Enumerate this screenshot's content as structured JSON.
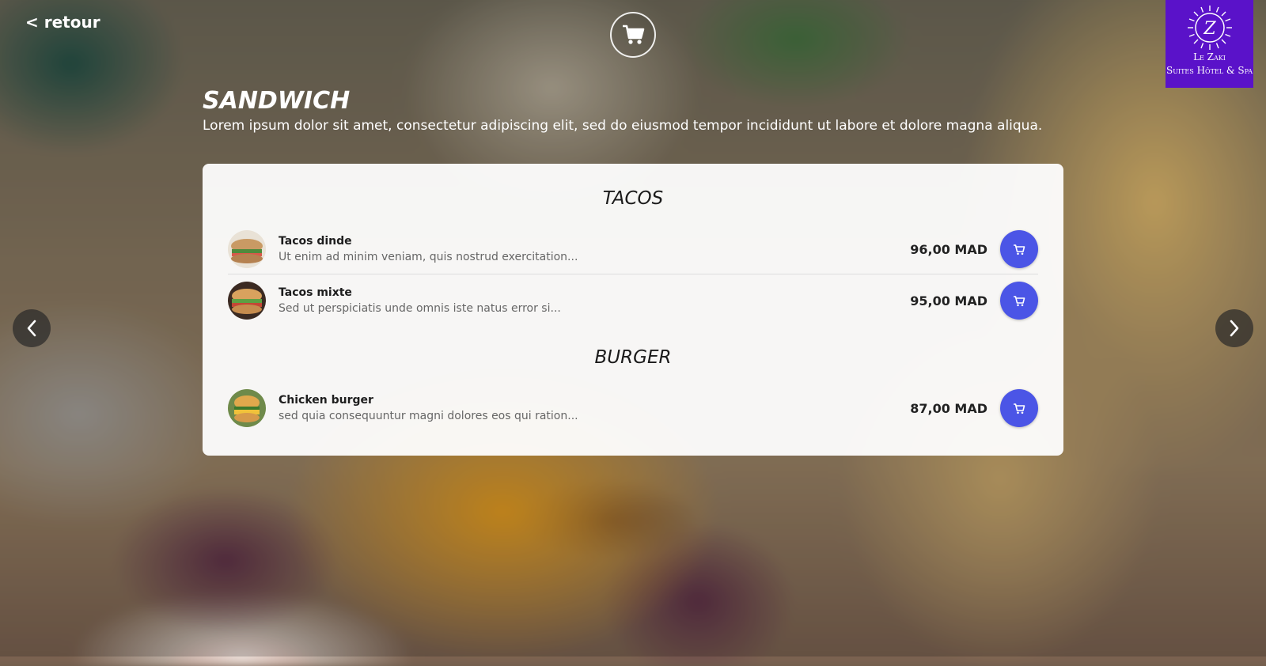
{
  "header": {
    "back_label": "< retour",
    "logo_line1": "Le Zaki",
    "logo_line2": "Suites Hôtel & Spa",
    "logo_mark": "Z"
  },
  "category": {
    "title": "SANDWICH",
    "description": "Lorem ipsum dolor sit amet, consectetur adipiscing elit, sed do eiusmod tempor incididunt ut labore et dolore magna aliqua."
  },
  "sections": [
    {
      "title": "TACOS",
      "items": [
        {
          "name": "Tacos dinde",
          "description": "Ut enim ad minim veniam, quis nostrud exercitation...",
          "price": "96,00 MAD"
        },
        {
          "name": "Tacos mixte",
          "description": "Sed ut perspiciatis unde omnis iste natus error si...",
          "price": "95,00 MAD"
        }
      ]
    },
    {
      "title": "BURGER",
      "items": [
        {
          "name": "Chicken burger",
          "description": "sed quia consequuntur magni dolores eos qui ration...",
          "price": "87,00 MAD"
        }
      ]
    }
  ],
  "colors": {
    "accent": "#4b55e6",
    "logo_bg": "#5a12c9"
  },
  "icons": {
    "cart": "shopping-cart-icon",
    "prev": "chevron-left-icon",
    "next": "chevron-right-icon"
  }
}
